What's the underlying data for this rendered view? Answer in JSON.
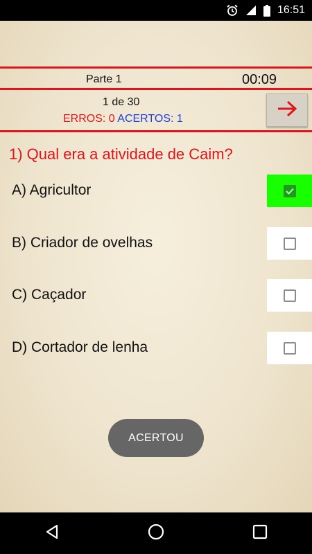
{
  "status_bar": {
    "time": "16:51",
    "icons": [
      "alarm-icon",
      "signal-icon",
      "battery-icon"
    ]
  },
  "quiz": {
    "part_label": "Parte 1",
    "timer": "00:09",
    "counter": "1 de 30",
    "errors_label": "ERROS: ",
    "errors_value": "0",
    "hits_label": "ACERTOS: ",
    "hits_value": "1",
    "question": "1) Qual era a atividade  de Caim?",
    "options": [
      {
        "text": "A) Agricultor",
        "checked": true
      },
      {
        "text": "B) Criador de ovelhas",
        "checked": false
      },
      {
        "text": "C) Caçador",
        "checked": false
      },
      {
        "text": "D) Cortador de lenha",
        "checked": false
      }
    ]
  },
  "toast": {
    "text": "ACERTOU"
  },
  "colors": {
    "accent_red": "#e0141b",
    "hits_blue": "#1f3fe0",
    "selected_green": "#18ff00"
  },
  "nav": [
    "back-icon",
    "home-icon",
    "recents-icon"
  ]
}
